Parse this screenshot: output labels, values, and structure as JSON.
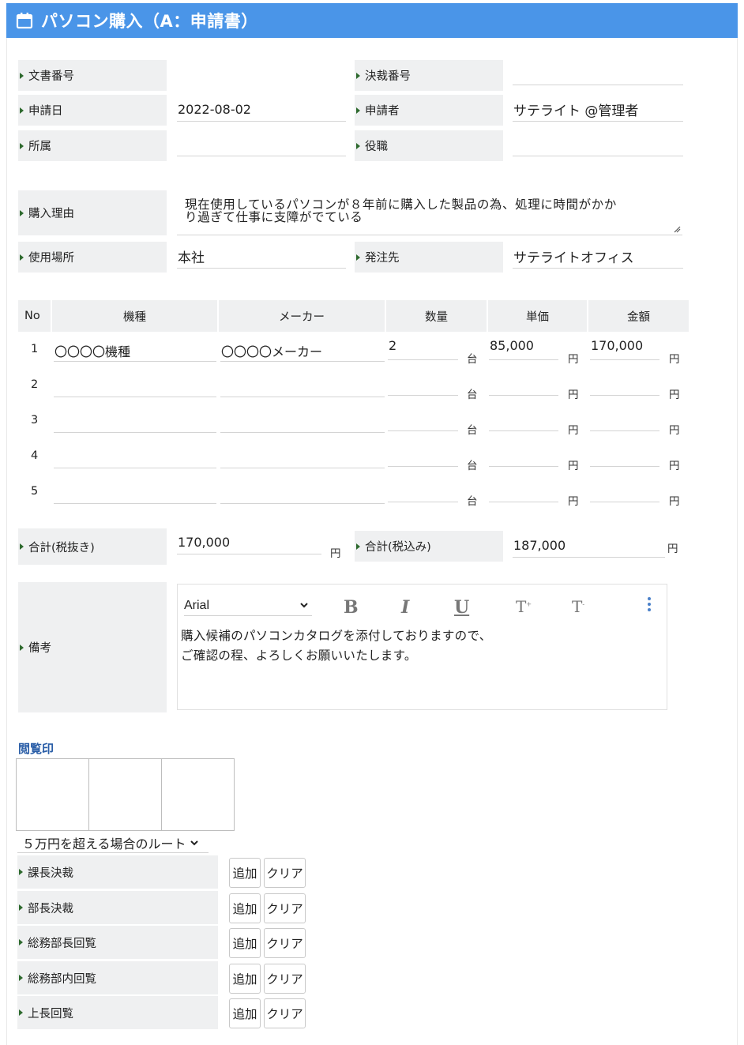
{
  "header": {
    "title": "パソコン購入（A：申請書）",
    "icon": "calendar-icon"
  },
  "fields": {
    "doc_no_label": "文書番号",
    "doc_no_value": "",
    "decision_no_label": "決裁番号",
    "decision_no_value": "",
    "apply_date_label": "申請日",
    "apply_date_value": "2022-08-02",
    "applicant_label": "申請者",
    "applicant_value": "サテライト @管理者",
    "dept_label": "所属",
    "dept_value": "",
    "position_label": "役職",
    "position_value": "",
    "reason_label": "購入理由",
    "reason_line1": "現在使用しているパソコンが８年前に購入した製品の為、処理に時間がかか",
    "reason_line2": "り過ぎて仕事に支障がでている",
    "place_label": "使用場所",
    "place_value": "本社",
    "vendor_label": "発注先",
    "vendor_value": "サテライトオフィス"
  },
  "table": {
    "headers": [
      "No",
      "機種",
      "メーカー",
      "数量",
      "単価",
      "金額"
    ],
    "qty_unit": "台",
    "yen_unit": "円",
    "rows": [
      {
        "no": "1",
        "model": "〇〇〇〇機種",
        "maker": "〇〇〇〇メーカー",
        "qty": "2",
        "price": "85,000",
        "amount": "170,000"
      },
      {
        "no": "2",
        "model": "",
        "maker": "",
        "qty": "",
        "price": "",
        "amount": ""
      },
      {
        "no": "3",
        "model": "",
        "maker": "",
        "qty": "",
        "price": "",
        "amount": ""
      },
      {
        "no": "4",
        "model": "",
        "maker": "",
        "qty": "",
        "price": "",
        "amount": ""
      },
      {
        "no": "5",
        "model": "",
        "maker": "",
        "qty": "",
        "price": "",
        "amount": ""
      }
    ]
  },
  "totals": {
    "excl_label": "合計(税抜き)",
    "excl_value": "170,000",
    "incl_label": "合計(税込み)",
    "incl_value": "187,000",
    "unit": "円"
  },
  "notes": {
    "label": "備考",
    "font": "Arial",
    "toolbar": {
      "bold": "B",
      "italic": "I",
      "underline": "U",
      "superscript": "T",
      "subscript": "T"
    },
    "line1": "購入候補のパソコンカタログを添付しておりますので、",
    "line2": "ご確認の程、よろしくお願いいたします。"
  },
  "approval": {
    "seal_title": "閲覧印",
    "route": "５万円を超える場合のルート",
    "steps": [
      "課長決裁",
      "部長決裁",
      "総務部長回覧",
      "総務部内回覧",
      "上長回覧"
    ],
    "add_label": "追加",
    "clear_label": "クリア"
  },
  "colors": {
    "header_bg": "#4a95e8",
    "label_bg": "#eff0f1",
    "seal_title": "#2a5ea7"
  }
}
